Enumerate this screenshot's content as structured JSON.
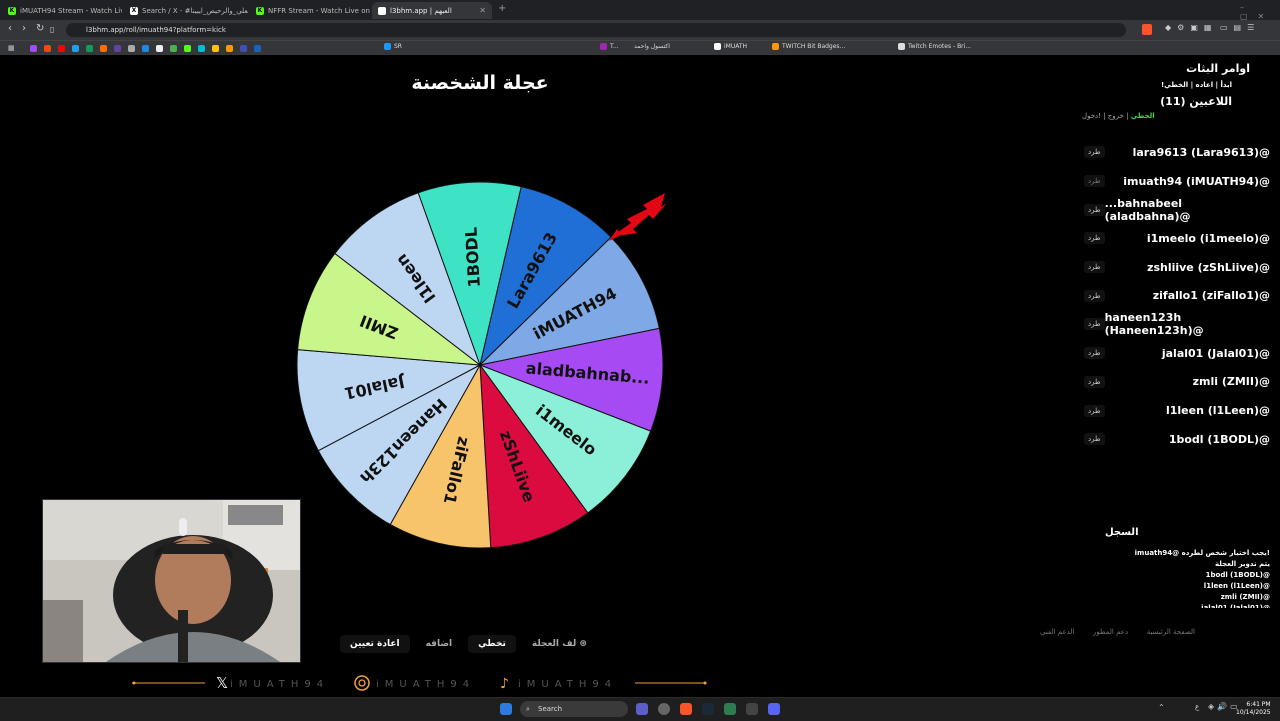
{
  "browser": {
    "tabs": [
      {
        "label": "iMUATH94 Stream - Watch Live",
        "icon": "kick-icon",
        "color": "#53fc18"
      },
      {
        "label": "Search / X - #العلي_والرحيص_ايبينا",
        "icon": "x-icon",
        "color": "#ffffff"
      },
      {
        "label": "NFFR Stream - Watch Live on Kick",
        "icon": "kick-icon",
        "color": "#53fc18"
      },
      {
        "label": "l3bhm.app | العبهم",
        "icon": "l3bhm-icon",
        "color": "#ffffff"
      }
    ],
    "url": "l3bhm.app/roll/imuath94?platform=kick",
    "bookmarks": [
      "SR",
      "T...",
      "اكتسول واحمد",
      "iMUATH",
      "TWITCH Bit Badges...",
      "Twitch Emotes - Bri..."
    ]
  },
  "wheel": {
    "title": "عجلة الشخصنة",
    "segments": [
      {
        "label": "Lara9613",
        "color": "#1f6fd6"
      },
      {
        "label": "iMUATH94",
        "color": "#7ea9e6"
      },
      {
        "label": "aladbahnab...",
        "color": "#a64bf4"
      },
      {
        "label": "i1meelo",
        "color": "#8cefd8"
      },
      {
        "label": "zShLiive",
        "color": "#db0b3f"
      },
      {
        "label": "ziFallo1",
        "color": "#f8c46b"
      },
      {
        "label": "Haneen123h",
        "color": "#bdd7f3"
      },
      {
        "label": "Jalal01",
        "color": "#bdd7f3"
      },
      {
        "label": "ZMII",
        "color": "#c8f68a"
      },
      {
        "label": "l1leen",
        "color": "#bdd7f3"
      },
      {
        "label": "1BODL",
        "color": "#3ee3c6"
      }
    ]
  },
  "controls": {
    "spin": "لف العجلة",
    "skip": "تخطي",
    "add": "اضافه",
    "reset": "اعادة تعيين"
  },
  "panel": {
    "commands_title": "اوامر البثات",
    "commands": "!ابدأ | اعاده | الخطي",
    "players_title": "اللاعبين (11)",
    "join": "!دخول",
    "leave": "خروج",
    "skip": "الخطي",
    "kick_label": "طرد",
    "players": [
      "lara9613 (Lara9613)@",
      "imuath94 (iMUATH94)@",
      "...bahnabeel (aladbahna)@",
      "i1meelo (i1meelo)@",
      "zshliive (zShLiive)@",
      "zifallo1 (ziFallo1)@",
      "haneen123h (Haneen123h)@",
      "jalal01 (Jalal01)@",
      "zmli (ZMII)@",
      "l1leen (l1Leen)@",
      "1bodl (1BODL)@"
    ],
    "log_title": "السجل",
    "log": [
      "imuath94@ يجب اختيار شخص لطرده!",
      "يتم تدوير العجلة",
      "1bodl (1BODL)@",
      "l1leen (l1Leen)@",
      "zmli (ZMII)@",
      "jalal01 (Jalal01)@"
    ],
    "footer_links": [
      "الصفحة الرئيسية",
      "دعم المطور",
      "الدعم الفني"
    ]
  },
  "brand": {
    "text": "iMUATH94"
  },
  "taskbar": {
    "search_placeholder": "Search",
    "time": "6:41 PM",
    "date": "10/14/2025",
    "lang": "ع"
  }
}
